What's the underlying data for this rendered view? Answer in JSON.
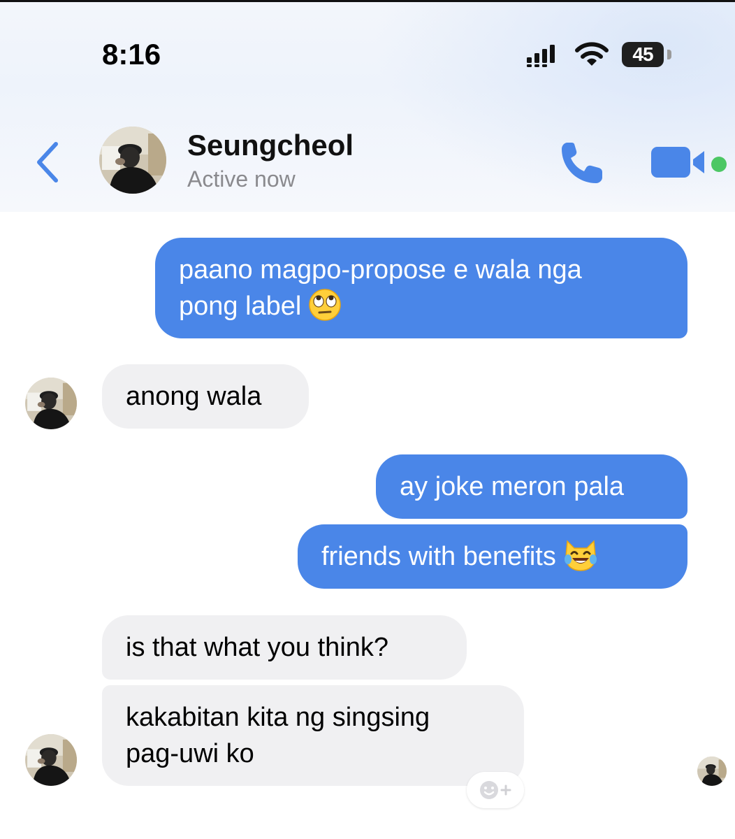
{
  "status_bar": {
    "time": "8:16",
    "battery": "45",
    "signal_icon": "cellular-signal-icon",
    "wifi_icon": "wifi-icon"
  },
  "header": {
    "contact_name": "Seungcheol",
    "status": "Active now",
    "back_icon": "chevron-left-icon",
    "call_icon": "phone-icon",
    "video_icon": "video-camera-icon",
    "accent_color": "#4a86e8",
    "active_color": "#4cc764"
  },
  "messages": [
    {
      "direction": "outgoing",
      "lines": [
        "paano magpo-propose e wala nga",
        "pong label"
      ],
      "emoji": "face-with-rolling-eyes"
    },
    {
      "direction": "incoming",
      "text": "anong wala"
    },
    {
      "direction": "outgoing",
      "text": "ay joke meron pala"
    },
    {
      "direction": "outgoing",
      "text": "friends with benefits",
      "emoji": "cat-with-tears-of-joy"
    },
    {
      "direction": "incoming",
      "text": "is that what you think?"
    },
    {
      "direction": "incoming",
      "lines": [
        "kakabitan kita ng singsing",
        "pag-uwi ko"
      ]
    }
  ],
  "reaction_button_icon": "add-reaction-icon",
  "colors": {
    "outgoing_bubble": "#4a86e8",
    "incoming_bubble": "#f0f0f2",
    "secondary_text": "#8a8a8e"
  }
}
